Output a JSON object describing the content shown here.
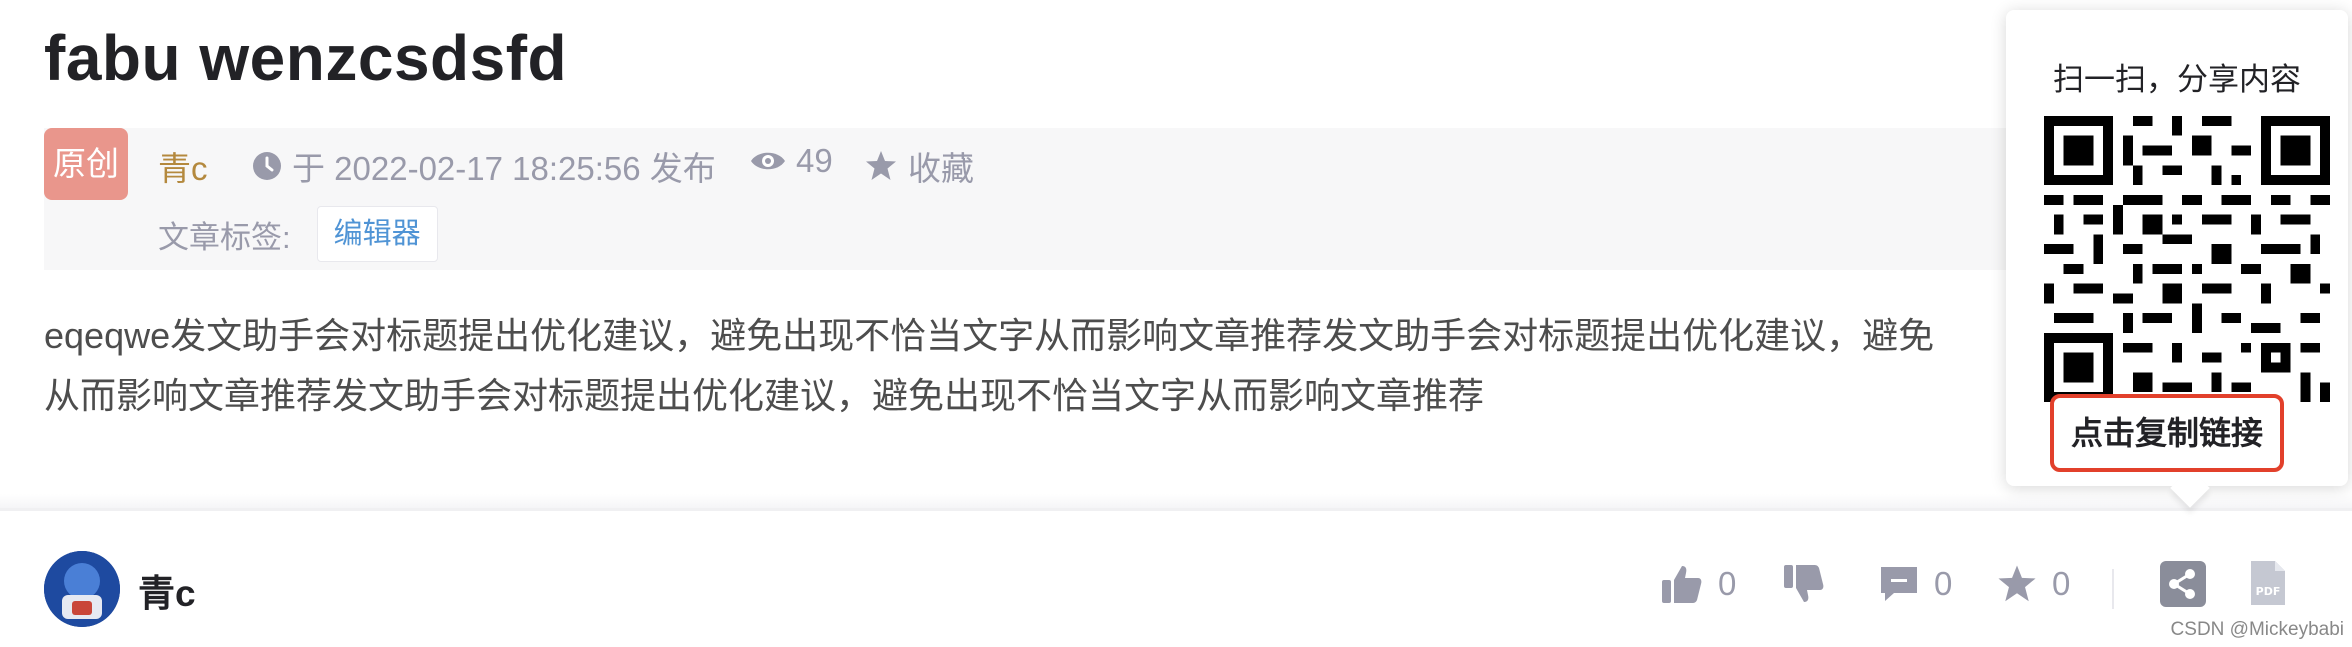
{
  "article": {
    "title": "fabu wenzcsdsfd",
    "badge": "原创",
    "author": "青c",
    "published": "于 2022-02-17 18:25:56 发布",
    "views": "49",
    "collect_label": "收藏",
    "tags_label": "文章标签:",
    "tags": [
      "编辑器"
    ],
    "content_line1": "eqeqwe发文助手会对标题提出优化建议，避免出现不恰当文字从而影响文章推荐发文助手会对标题提出优化建议，避免",
    "content_line2": "从而影响文章推荐发文助手会对标题提出优化建议，避免出现不恰当文字从而影响文章推荐"
  },
  "bottom": {
    "username": "青c",
    "like_count": "0",
    "comment_count": "0",
    "collect_count": "0"
  },
  "share": {
    "title": "扫一扫，分享内容",
    "copy_link": "点击复制链接"
  },
  "watermark": "CSDN @Mickeybabi",
  "colors": {
    "author": "#b4893e",
    "tag": "#5094d5",
    "muted": "#999aaa",
    "highlight": "#e2402b"
  }
}
